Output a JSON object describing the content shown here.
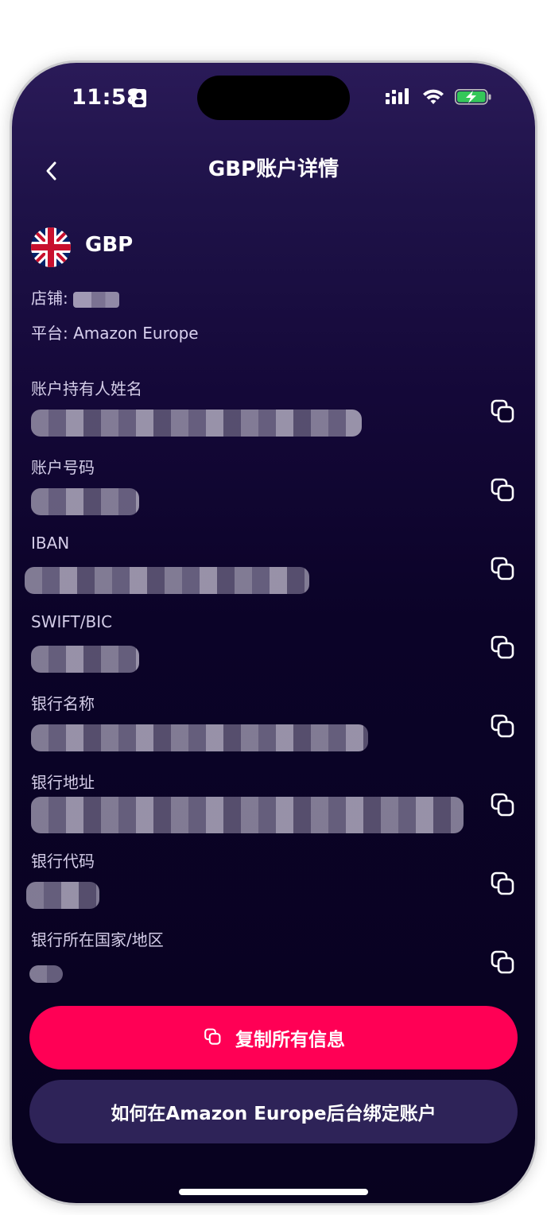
{
  "status_bar": {
    "time": "11:58"
  },
  "header": {
    "back_icon": "chevron-left-icon",
    "title": "GBP账户详情"
  },
  "account": {
    "flag_icon": "uk-flag-icon",
    "currency": "GBP",
    "store_label": "店铺:",
    "platform_line": "平台: Amazon Europe"
  },
  "fields": [
    {
      "label": "账户持有人姓名"
    },
    {
      "label": "账户号码"
    },
    {
      "label": "IBAN"
    },
    {
      "label": "SWIFT/BIC"
    },
    {
      "label": "银行名称"
    },
    {
      "label": "银行地址"
    },
    {
      "label": "银行代码"
    },
    {
      "label": "银行所在国家/地区"
    }
  ],
  "actions": {
    "copy_all_label": "复制所有信息",
    "bind_help_label": "如何在Amazon Europe后台绑定账户"
  },
  "colors": {
    "accent": "#ff0055",
    "secondary_button": "#2e2358",
    "background_top": "#2a1a58",
    "background_bottom": "#08021f"
  }
}
